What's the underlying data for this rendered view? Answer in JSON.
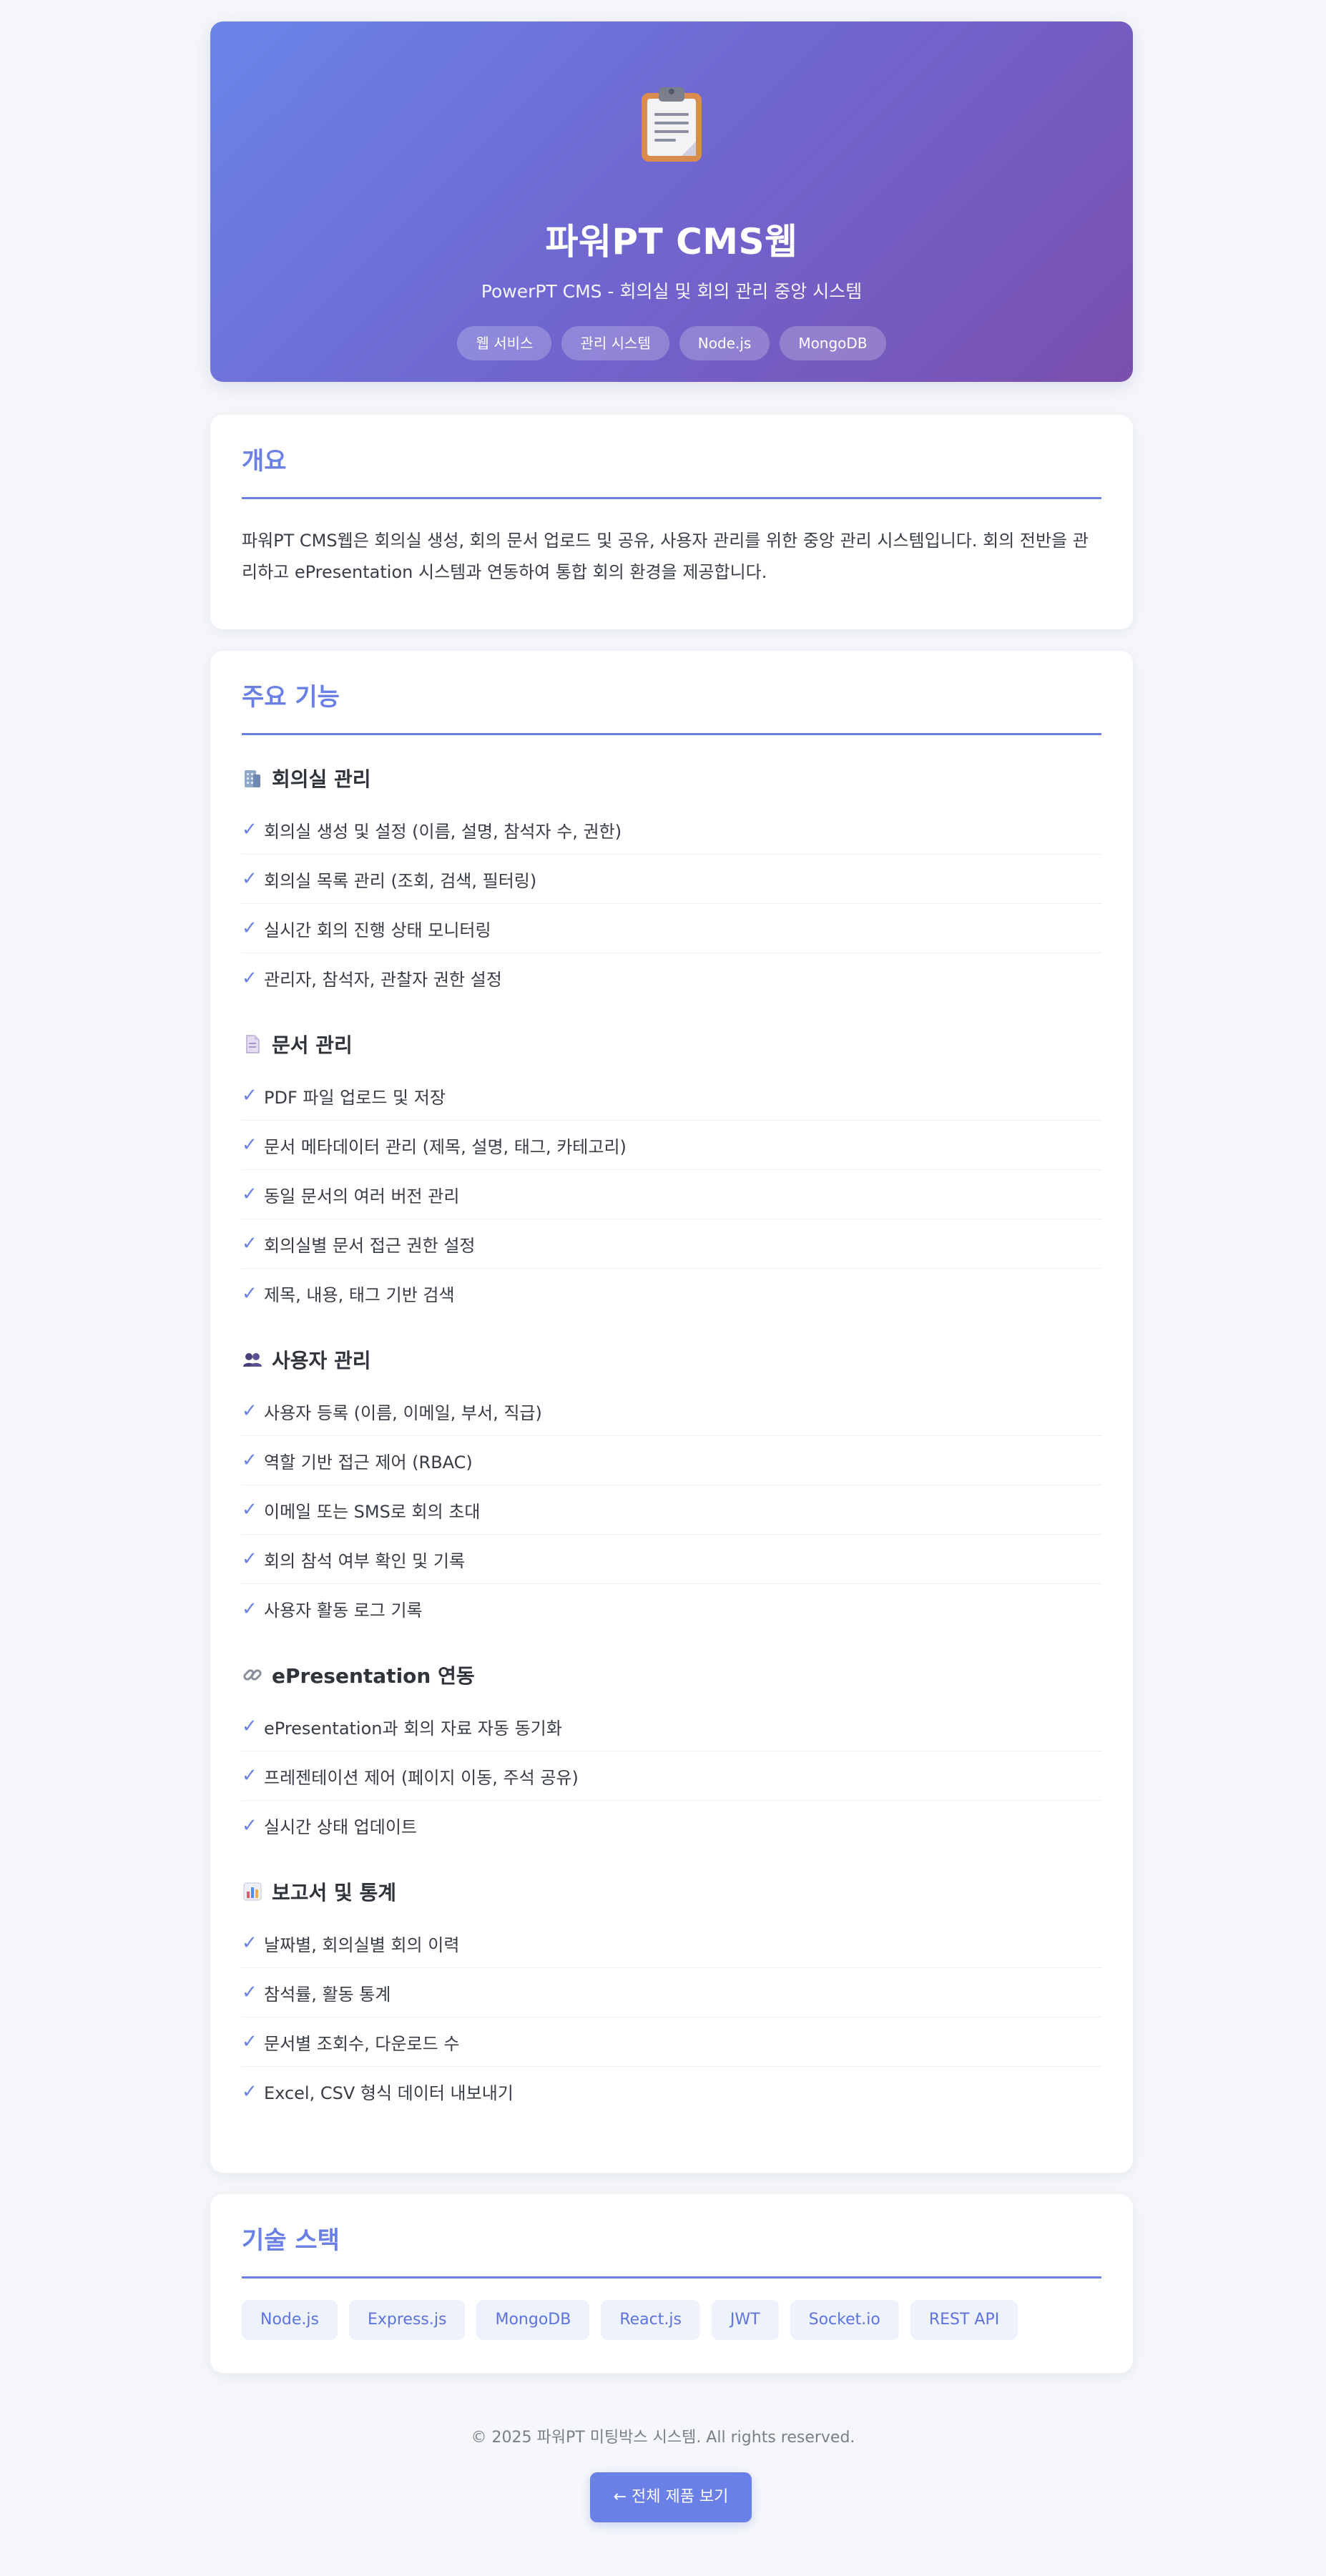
{
  "hero": {
    "title": "파워PT CMS웹",
    "subtitle": "PowerPT CMS - 회의실 및 회의 관리 중앙 시스템",
    "tags": [
      "웹 서비스",
      "관리 시스템",
      "Node.js",
      "MongoDB"
    ],
    "icon": "clipboard-icon"
  },
  "overview": {
    "heading": "개요",
    "text": "파워PT CMS웹은 회의실 생성, 회의 문서 업로드 및 공유, 사용자 관리를 위한 중앙 관리 시스템입니다. 회의 전반을 관리하고 ePresentation 시스템과 연동하여 통합 회의 환경을 제공합니다."
  },
  "features": {
    "heading": "주요 기능",
    "sections": [
      {
        "icon": "building-icon",
        "title": "회의실 관리",
        "items": [
          "회의실 생성 및 설정 (이름, 설명, 참석자 수, 권한)",
          "회의실 목록 관리 (조회, 검색, 필터링)",
          "실시간 회의 진행 상태 모니터링",
          "관리자, 참석자, 관찰자 권한 설정"
        ]
      },
      {
        "icon": "document-icon",
        "title": "문서 관리",
        "items": [
          "PDF 파일 업로드 및 저장",
          "문서 메타데이터 관리 (제목, 설명, 태그, 카테고리)",
          "동일 문서의 여러 버전 관리",
          "회의실별 문서 접근 권한 설정",
          "제목, 내용, 태그 기반 검색"
        ]
      },
      {
        "icon": "users-icon",
        "title": "사용자 관리",
        "items": [
          "사용자 등록 (이름, 이메일, 부서, 직급)",
          "역할 기반 접근 제어 (RBAC)",
          "이메일 또는 SMS로 회의 초대",
          "회의 참석 여부 확인 및 기록",
          "사용자 활동 로그 기록"
        ]
      },
      {
        "icon": "link-icon",
        "title": "ePresentation 연동",
        "items": [
          "ePresentation과 회의 자료 자동 동기화",
          "프레젠테이션 제어 (페이지 이동, 주석 공유)",
          "실시간 상태 업데이트"
        ]
      },
      {
        "icon": "bar-chart-icon",
        "title": "보고서 및 통계",
        "items": [
          "날짜별, 회의실별 회의 이력",
          "참석률, 활동 통계",
          "문서별 조회수, 다운로드 수",
          "Excel, CSV 형식 데이터 내보내기"
        ]
      }
    ]
  },
  "tech": {
    "heading": "기술 스택",
    "items": [
      "Node.js",
      "Express.js",
      "MongoDB",
      "React.js",
      "JWT",
      "Socket.io",
      "REST API"
    ]
  },
  "footer": {
    "copyright": "© 2025 파워PT 미팅박스 시스템. All rights reserved.",
    "back_label": "← 전체 제품 보기"
  },
  "colors": {
    "accent": "#6b80e6",
    "hero_start": "#6a85e8",
    "hero_end": "#7a4fae",
    "background": "#f5f7fa"
  }
}
